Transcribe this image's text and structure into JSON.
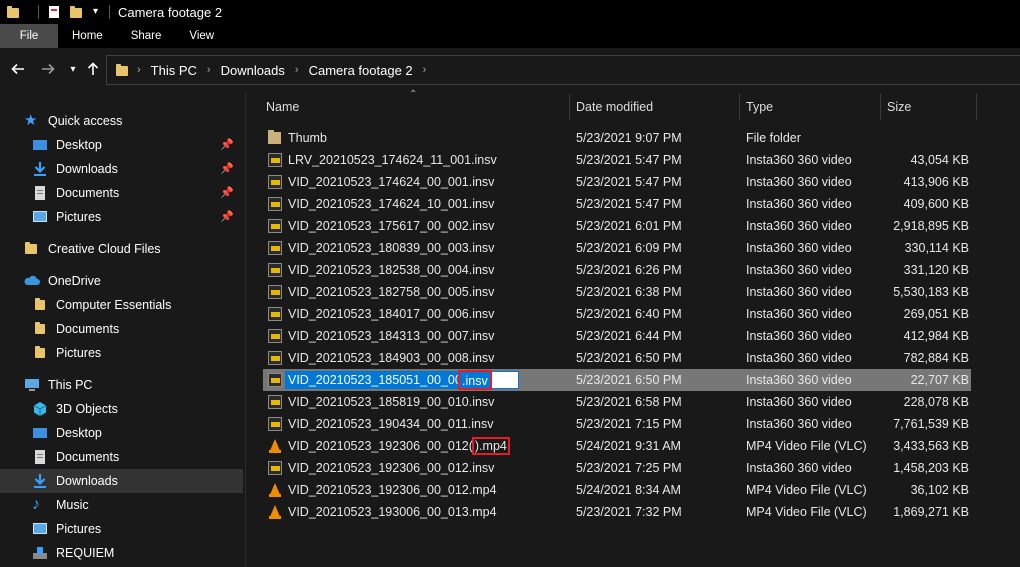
{
  "window": {
    "title": "Camera footage 2"
  },
  "ribbon": {
    "tabs": [
      "File",
      "Home",
      "Share",
      "View"
    ]
  },
  "breadcrumb": [
    "This PC",
    "Downloads",
    "Camera footage 2"
  ],
  "sidebar": {
    "items": [
      {
        "label": "Quick access",
        "icon": "star-icon"
      },
      {
        "label": "Desktop",
        "icon": "desktop-icon",
        "pinned": true
      },
      {
        "label": "Downloads",
        "icon": "download-icon",
        "pinned": true
      },
      {
        "label": "Documents",
        "icon": "documents-icon",
        "pinned": true
      },
      {
        "label": "Pictures",
        "icon": "pictures-icon",
        "pinned": true
      },
      {
        "label": "Creative Cloud Files",
        "icon": "creative-cloud-icon"
      },
      {
        "label": "OneDrive",
        "icon": "onedrive-icon"
      },
      {
        "label": "Computer Essentials",
        "icon": "folder-icon"
      },
      {
        "label": "Documents",
        "icon": "folder-icon"
      },
      {
        "label": "Pictures",
        "icon": "folder-icon"
      },
      {
        "label": "This PC",
        "icon": "pc-icon"
      },
      {
        "label": "3D Objects",
        "icon": "3d-objects-icon"
      },
      {
        "label": "Desktop",
        "icon": "desktop-icon"
      },
      {
        "label": "Documents",
        "icon": "documents-icon"
      },
      {
        "label": "Downloads",
        "icon": "download-icon",
        "selected": true
      },
      {
        "label": "Music",
        "icon": "music-icon"
      },
      {
        "label": "Pictures",
        "icon": "pictures-icon"
      },
      {
        "label": "REQUIEM",
        "icon": "drive-icon"
      }
    ]
  },
  "columns": {
    "name": "Name",
    "date": "Date modified",
    "type": "Type",
    "size": "Size"
  },
  "files": [
    {
      "name": "Thumb",
      "date": "5/23/2021 9:07 PM",
      "type": "File folder",
      "size": "",
      "icon": "folder"
    },
    {
      "name": "LRV_20210523_174624_11_001.insv",
      "date": "5/23/2021 5:47 PM",
      "type": "Insta360 360 video",
      "size": "43,054 KB",
      "icon": "insv"
    },
    {
      "name": "VID_20210523_174624_00_001.insv",
      "date": "5/23/2021 5:47 PM",
      "type": "Insta360 360 video",
      "size": "413,906 KB",
      "icon": "insv"
    },
    {
      "name": "VID_20210523_174624_10_001.insv",
      "date": "5/23/2021 5:47 PM",
      "type": "Insta360 360 video",
      "size": "409,600 KB",
      "icon": "insv"
    },
    {
      "name": "VID_20210523_175617_00_002.insv",
      "date": "5/23/2021 6:01 PM",
      "type": "Insta360 360 video",
      "size": "2,918,895 KB",
      "icon": "insv"
    },
    {
      "name": "VID_20210523_180839_00_003.insv",
      "date": "5/23/2021 6:09 PM",
      "type": "Insta360 360 video",
      "size": "330,114 KB",
      "icon": "insv"
    },
    {
      "name": "VID_20210523_182538_00_004.insv",
      "date": "5/23/2021 6:26 PM",
      "type": "Insta360 360 video",
      "size": "331,120 KB",
      "icon": "insv"
    },
    {
      "name": "VID_20210523_182758_00_005.insv",
      "date": "5/23/2021 6:38 PM",
      "type": "Insta360 360 video",
      "size": "5,530,183 KB",
      "icon": "insv"
    },
    {
      "name": "VID_20210523_184017_00_006.insv",
      "date": "5/23/2021 6:40 PM",
      "type": "Insta360 360 video",
      "size": "269,051 KB",
      "icon": "insv"
    },
    {
      "name": "VID_20210523_184313_00_007.insv",
      "date": "5/23/2021 6:44 PM",
      "type": "Insta360 360 video",
      "size": "412,984 KB",
      "icon": "insv"
    },
    {
      "name": "VID_20210523_184903_00_008.insv",
      "date": "5/23/2021 6:50 PM",
      "type": "Insta360 360 video",
      "size": "782,884 KB",
      "icon": "insv"
    },
    {
      "name": "VID_20210523_185051_00_009.insv",
      "name_base": "VID_20210523_185051_00_009",
      "name_ext": ".insv",
      "date": "5/23/2021 6:50 PM",
      "type": "Insta360 360 video",
      "size": "22,707 KB",
      "icon": "insv",
      "renaming": true
    },
    {
      "name": "VID_20210523_185819_00_010.insv",
      "date": "5/23/2021 6:58 PM",
      "type": "Insta360 360 video",
      "size": "228,078 KB",
      "icon": "insv"
    },
    {
      "name": "VID_20210523_190434_00_011.insv",
      "date": "5/23/2021 7:15 PM",
      "type": "Insta360 360 video",
      "size": "7,761,539 KB",
      "icon": "insv"
    },
    {
      "name": "VID_20210523_192306_00_012(1).mp4",
      "name_base": "VID_20210523_192306_00_012(",
      "name_ext": ").mp4",
      "date": "5/24/2021 9:31 AM",
      "type": "MP4 Video File (VLC)",
      "size": "3,433,563 KB",
      "icon": "vlc",
      "highlight_ext": true
    },
    {
      "name": "VID_20210523_192306_00_012.insv",
      "date": "5/23/2021 7:25 PM",
      "type": "Insta360 360 video",
      "size": "1,458,203 KB",
      "icon": "insv"
    },
    {
      "name": "VID_20210523_192306_00_012.mp4",
      "date": "5/24/2021 8:34 AM",
      "type": "MP4 Video File (VLC)",
      "size": "36,102 KB",
      "icon": "vlc"
    },
    {
      "name": "VID_20210523_193006_00_013.mp4",
      "date": "5/23/2021 7:32 PM",
      "type": "MP4 Video File (VLC)",
      "size": "1,869,271 KB",
      "icon": "vlc"
    }
  ],
  "colors": {
    "accent": "#0078d7",
    "highlight": "#e51c23",
    "selected_row": "#777777"
  }
}
